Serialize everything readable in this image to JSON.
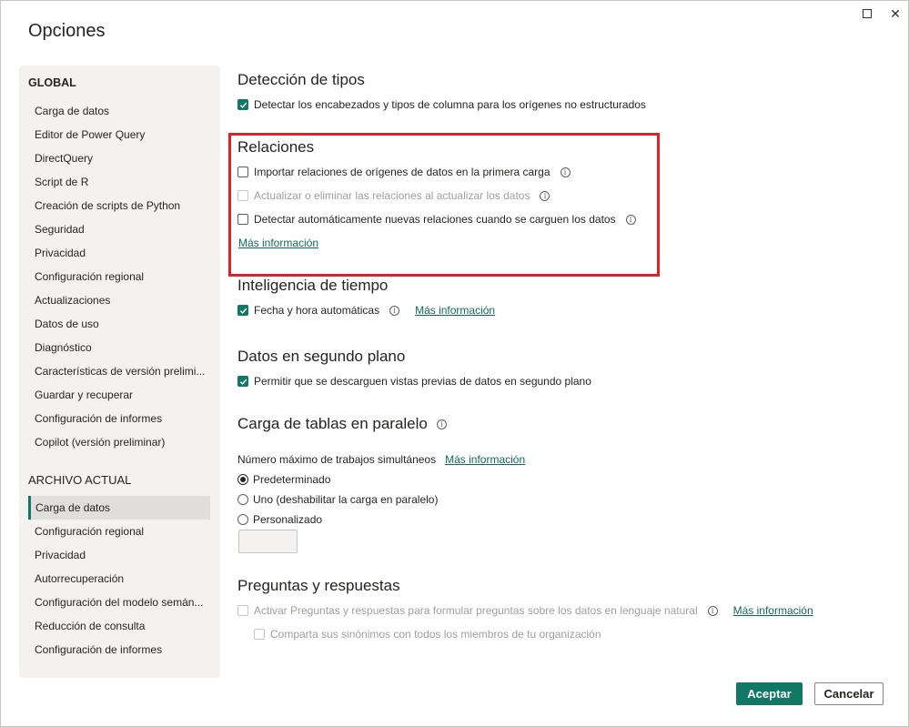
{
  "window": {
    "title": "Opciones",
    "maximize_icon": "maximize-icon",
    "close_icon": "close-icon",
    "close_glyph": "✕"
  },
  "sidebar": {
    "global_header": "GLOBAL",
    "global_items": [
      {
        "label": "Carga de datos"
      },
      {
        "label": "Editor de Power Query"
      },
      {
        "label": "DirectQuery"
      },
      {
        "label": "Script de R"
      },
      {
        "label": "Creación de scripts de Python"
      },
      {
        "label": "Seguridad"
      },
      {
        "label": "Privacidad"
      },
      {
        "label": "Configuración regional"
      },
      {
        "label": "Actualizaciones"
      },
      {
        "label": "Datos de uso"
      },
      {
        "label": "Diagnóstico"
      },
      {
        "label": "Características de versión prelimi..."
      },
      {
        "label": "Guardar y recuperar"
      },
      {
        "label": "Configuración de informes"
      },
      {
        "label": "Copilot (versión preliminar)"
      }
    ],
    "current_header": "ARCHIVO ACTUAL",
    "current_items": [
      {
        "label": "Carga de datos",
        "selected": true
      },
      {
        "label": "Configuración regional"
      },
      {
        "label": "Privacidad"
      },
      {
        "label": "Autorrecuperación"
      },
      {
        "label": "Configuración del modelo semán..."
      },
      {
        "label": "Reducción de consulta"
      },
      {
        "label": "Configuración de informes"
      }
    ]
  },
  "sections": {
    "type_detection": {
      "title": "Detección de tipos",
      "option": "Detectar los encabezados y tipos de columna para los orígenes no estructurados",
      "checked": true
    },
    "relationships": {
      "title": "Relaciones",
      "option1": "Importar relaciones de orígenes de datos en la primera carga",
      "option2": "Actualizar o eliminar las relaciones al actualizar los datos",
      "option3": "Detectar automáticamente nuevas relaciones cuando se carguen los datos",
      "more_info": "Más información"
    },
    "time_intelligence": {
      "title": "Inteligencia de tiempo",
      "option": "Fecha y hora automáticas",
      "checked": true,
      "more_info": "Más información"
    },
    "background_data": {
      "title": "Datos en segundo plano",
      "option": "Permitir que se descarguen vistas previas de datos en segundo plano",
      "checked": true
    },
    "parallel_loading": {
      "title": "Carga de tablas en paralelo",
      "label": "Número máximo de trabajos simultáneos",
      "more_info": "Más información",
      "radio_default": "Predeterminado",
      "radio_one": "Uno (deshabilitar la carga en paralelo)",
      "radio_custom": "Personalizado",
      "selected": "Predeterminado"
    },
    "qna": {
      "title": "Preguntas y respuestas",
      "option1": "Activar Preguntas y respuestas para formular preguntas sobre los datos en lenguaje natural",
      "more_info": "Más información",
      "option2": "Comparta sus sinónimos con todos los miembros de tu organización"
    }
  },
  "buttons": {
    "ok": "Aceptar",
    "cancel": "Cancelar"
  },
  "colors": {
    "accent": "#117865",
    "highlight_box": "#e0202b",
    "sidebar_bg": "#f3f2f1"
  }
}
